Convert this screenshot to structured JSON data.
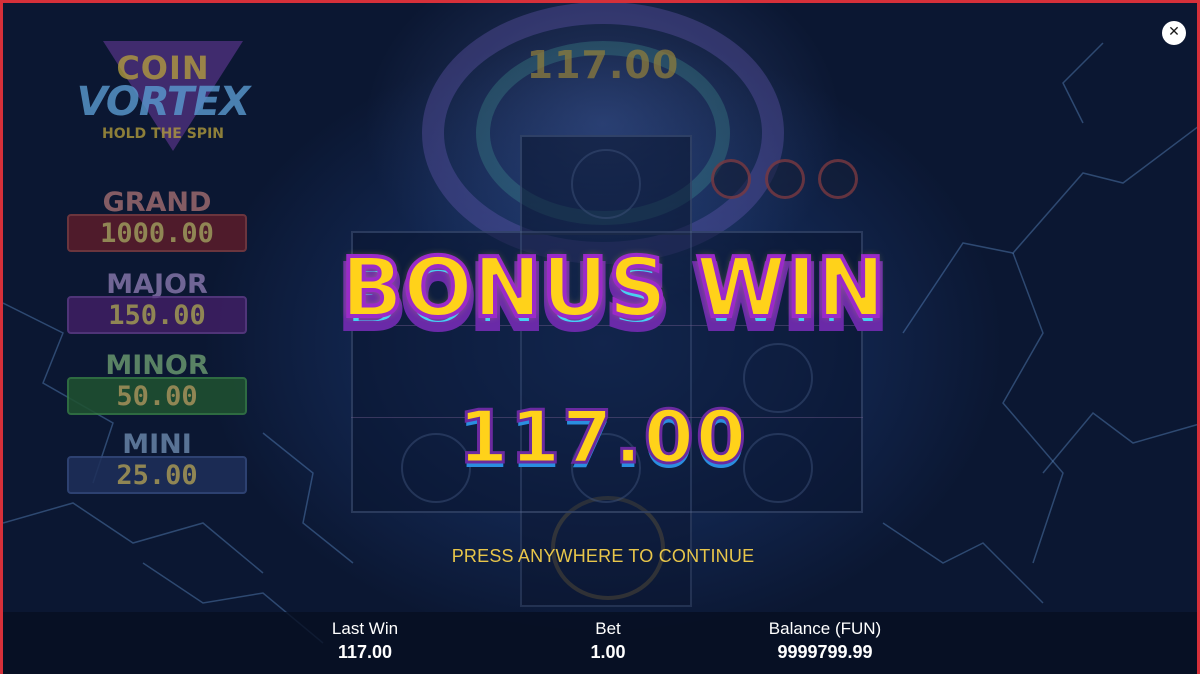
{
  "logo": {
    "line1": "COIN",
    "line2": "VORTEX",
    "line3": "HOLD THE SPIN"
  },
  "jackpots": [
    {
      "label": "GRAND",
      "value": "1000.00"
    },
    {
      "label": "MAJOR",
      "value": "150.00"
    },
    {
      "label": "MINOR",
      "value": "50.00"
    },
    {
      "label": "MINI",
      "value": "25.00"
    }
  ],
  "top_amount": "117.00",
  "overlay": {
    "title": "BONUS WIN",
    "amount": "117.00",
    "prompt": "PRESS ANYWHERE TO CONTINUE"
  },
  "close_icon": "✕",
  "status_bar": {
    "last_win_label": "Last Win",
    "last_win_value": "117.00",
    "bet_label": "Bet",
    "bet_value": "1.00",
    "balance_label": "Balance (FUN)",
    "balance_value": "9999799.99"
  },
  "colors": {
    "border": "#d6303a",
    "gold": "#ffd21a",
    "purple_outline": "#9b2ac8",
    "prompt": "#e8c64a"
  }
}
